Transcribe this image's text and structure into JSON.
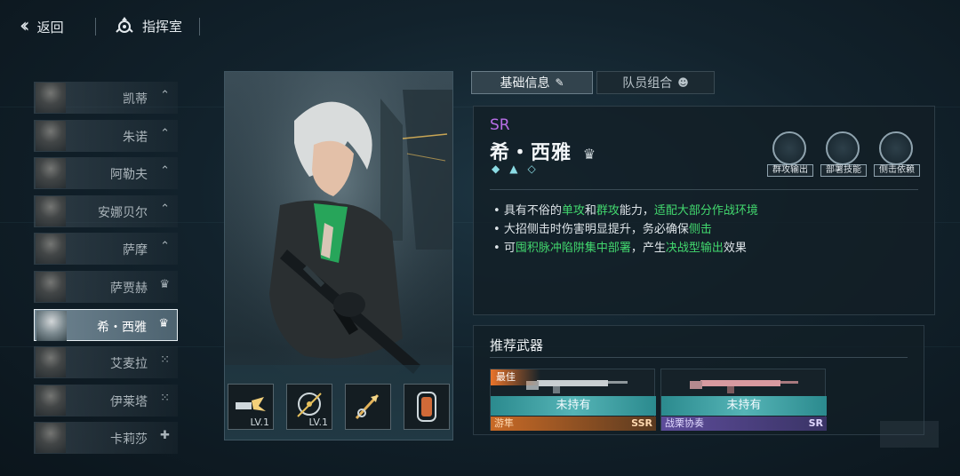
{
  "topbar": {
    "back_label": "返回",
    "room_label": "指挥室"
  },
  "roster": [
    {
      "name": "凯蒂",
      "icon": "rank-chevron-icon",
      "glyph": "⌃"
    },
    {
      "name": "朱诺",
      "icon": "rank-chevron-icon",
      "glyph": "⌃"
    },
    {
      "name": "阿勒夫",
      "icon": "rank-chevron-icon",
      "glyph": "⌃"
    },
    {
      "name": "安娜贝尔",
      "icon": "rank-chevron-icon",
      "glyph": "⌃"
    },
    {
      "name": "萨摩",
      "icon": "rank-chevron-icon",
      "glyph": "⌃"
    },
    {
      "name": "萨贾赫",
      "icon": "crown-icon",
      "glyph": "♛"
    },
    {
      "name": "希・西雅",
      "icon": "crown-icon",
      "glyph": "♛",
      "selected": true
    },
    {
      "name": "艾麦拉",
      "icon": "grid-icon",
      "glyph": "⁙"
    },
    {
      "name": "伊莱塔",
      "icon": "grid-icon",
      "glyph": "⁙"
    },
    {
      "name": "卡莉莎",
      "icon": "plus-icon",
      "glyph": "✚"
    }
  ],
  "skills": [
    {
      "icon": "burst-shot-icon",
      "level": "LV.1"
    },
    {
      "icon": "target-reticle-icon",
      "level": "LV.1"
    },
    {
      "icon": "arrow-strike-icon",
      "level": ""
    },
    {
      "icon": "canister-icon",
      "level": ""
    }
  ],
  "tabs": {
    "info": "基础信息",
    "team": "队员组合"
  },
  "character": {
    "rarity": "SR",
    "name": "希・西雅",
    "roles": [
      {
        "label": "群攻输出",
        "icon": "aoe-attack-icon"
      },
      {
        "label": "部署技能",
        "icon": "deploy-skill-icon"
      },
      {
        "label": "侧击依赖",
        "icon": "flank-icon"
      }
    ],
    "description": [
      [
        {
          "t": "具有不俗的",
          "hl": false
        },
        {
          "t": "单攻",
          "hl": true
        },
        {
          "t": "和",
          "hl": false
        },
        {
          "t": "群攻",
          "hl": true
        },
        {
          "t": "能力，",
          "hl": false
        },
        {
          "t": "适配大部分作战环境",
          "hl": true
        }
      ],
      [
        {
          "t": "大招侧击时伤害明显提升，务必确保",
          "hl": false
        },
        {
          "t": "侧击",
          "hl": true
        }
      ],
      [
        {
          "t": "可",
          "hl": false
        },
        {
          "t": "囤积脉冲陷阱集中部署",
          "hl": true
        },
        {
          "t": "，产生",
          "hl": false
        },
        {
          "t": "决战型输出",
          "hl": true
        },
        {
          "t": "效果",
          "hl": false
        }
      ]
    ]
  },
  "weapons": {
    "title": "推荐武器",
    "items": [
      {
        "best": "最佳",
        "status": "未持有",
        "name": "游隼",
        "rarity": "SSR"
      },
      {
        "best": "",
        "status": "未持有",
        "name": "战栗协奏",
        "rarity": "SR"
      }
    ]
  },
  "colors": {
    "accent_green": "#42d86e",
    "rarity_sr": "#b86ee6",
    "ssr_bar": "#c96a26",
    "sr_bar": "#5d4c9a",
    "teal_status": "#55b4b6"
  }
}
